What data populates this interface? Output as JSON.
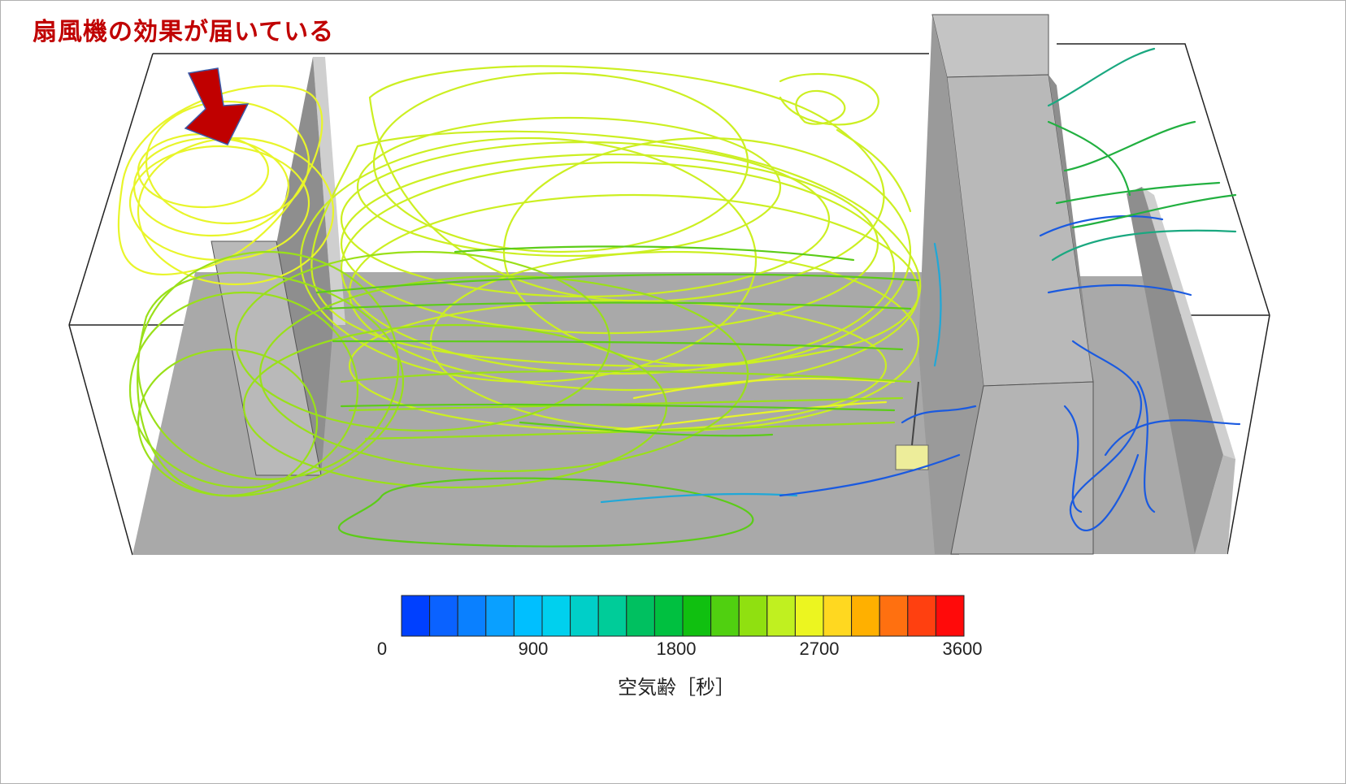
{
  "headline": "扇風機の効果が届いている",
  "legend": {
    "title": "空気齢［秒］",
    "unit": "秒",
    "min": 0,
    "max": 3600,
    "ticks": [
      "0",
      "900",
      "1800",
      "2700",
      "3600"
    ],
    "tick_values": [
      0,
      900,
      1800,
      2700,
      3600
    ],
    "colors": [
      "#0040ff",
      "#0a62ff",
      "#0a80ff",
      "#0aa0ff",
      "#00bfff",
      "#00d0ee",
      "#00cfc8",
      "#00cc99",
      "#00c060",
      "#00c040",
      "#10c010",
      "#50d010",
      "#90e010",
      "#c0f020",
      "#ecf520",
      "#ffd820",
      "#ffb000",
      "#ff7010",
      "#ff4010",
      "#ff0a0a"
    ]
  },
  "annotation": {
    "arrow_color": "#c00000",
    "target": "fan-airflow"
  },
  "scene_colors": {
    "floor": "#a9a9a9",
    "wall_front": "#b9b9b9",
    "wall_side": "#8e8e8e",
    "wall_top": "#cfcfcf",
    "box_edge": "#222222",
    "fan": "#eded9a"
  }
}
